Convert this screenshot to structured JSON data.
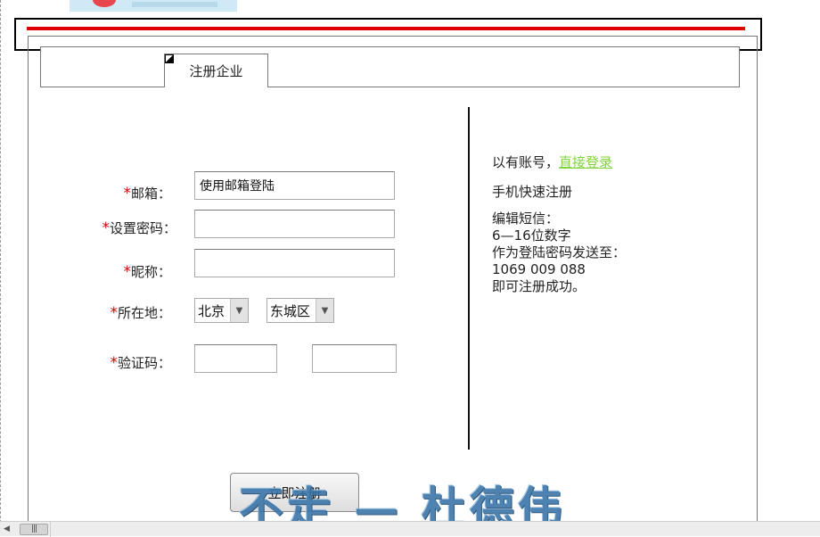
{
  "tabs": [
    {
      "label": "注册企业"
    }
  ],
  "form": {
    "required_mark": "*",
    "email": {
      "label": "邮箱：",
      "value": "使用邮箱登陆"
    },
    "password": {
      "label": "设置密码：",
      "value": ""
    },
    "nickname": {
      "label": "昵称：",
      "value": ""
    },
    "location": {
      "label": "所在地：",
      "city": "北京",
      "district": "东城区"
    },
    "captcha": {
      "label": "验证码：",
      "value": ""
    },
    "submit_label": "立即注册"
  },
  "side_panel": {
    "have_account": "以有账号，",
    "login_link": "直接登录",
    "quick_register": "手机快速注册",
    "sms_lines": [
      "编辑短信：",
      "6—16位数字",
      "作为登陆密码发送至：",
      "1069 009 088",
      "即可注册成功。"
    ]
  },
  "watermark": "不走 — 杜德伟",
  "colors": {
    "accent_red": "#e00000",
    "required_star": "#d00000",
    "link_green": "#7fd43d",
    "watermark_blue": "#3b75a8"
  },
  "icons": {
    "dropdown": "triangle-down",
    "tab_corner": "diagonal-corner",
    "scroll_left": "triangle-left"
  }
}
